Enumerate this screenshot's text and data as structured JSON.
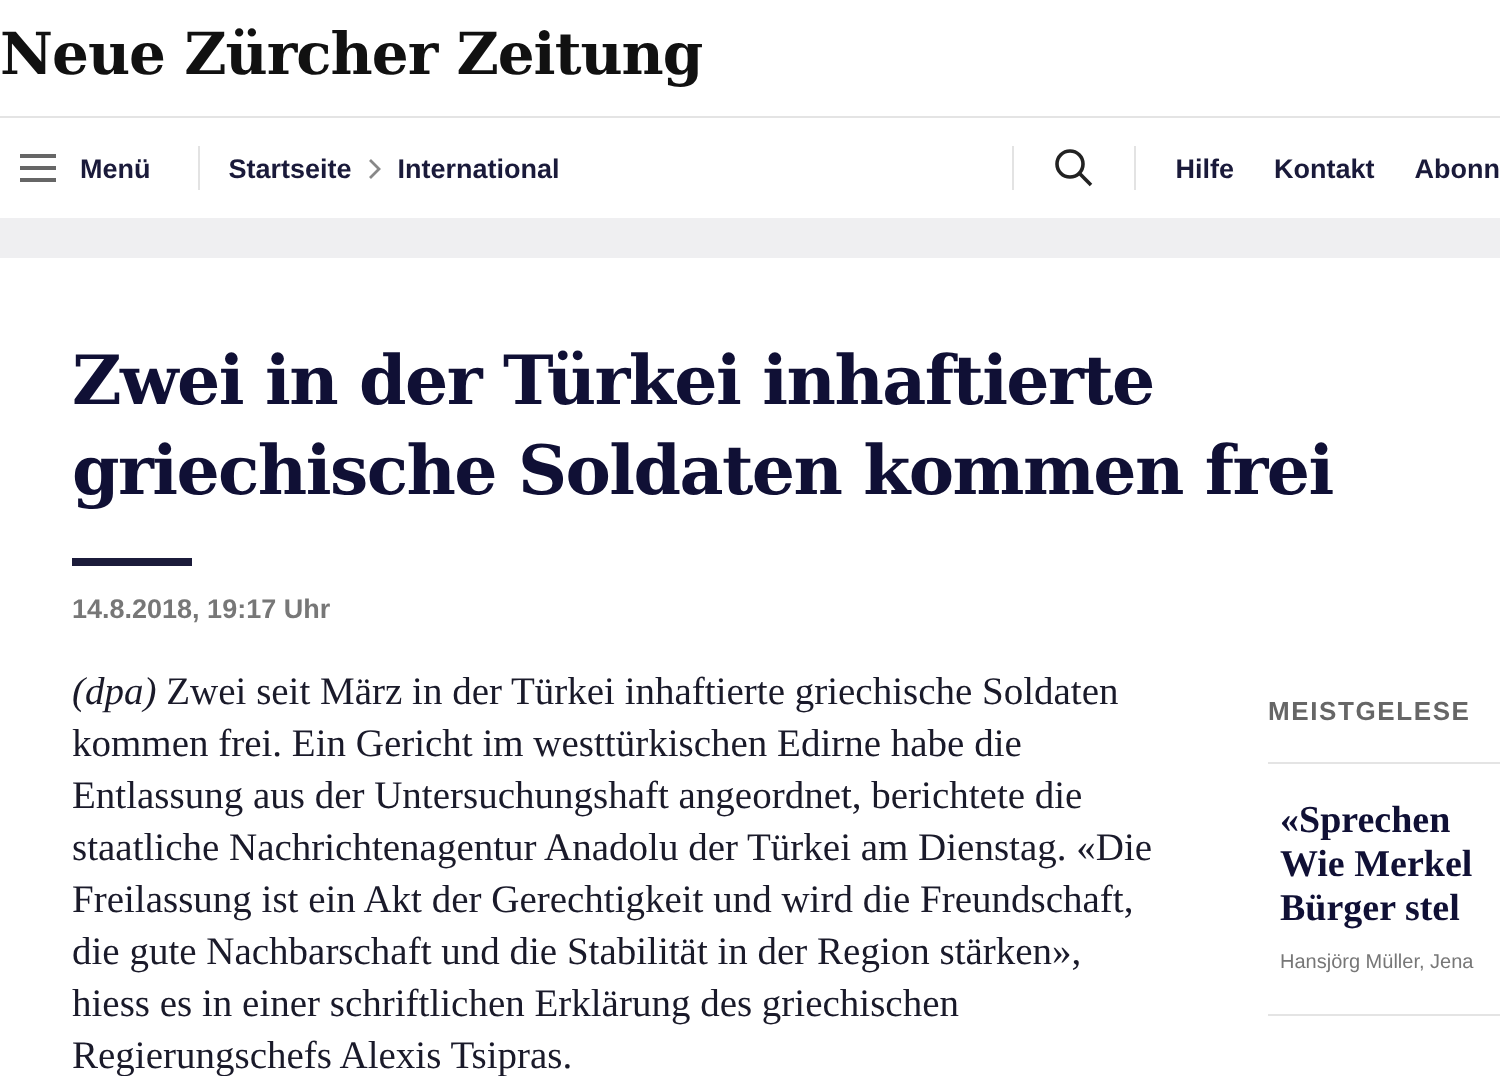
{
  "logo": "Neue Zürcher Zeitung",
  "nav": {
    "menu": "Menü",
    "breadcrumbs": [
      "Startseite",
      "International"
    ],
    "links": [
      "Hilfe",
      "Kontakt",
      "Abonn"
    ]
  },
  "article": {
    "title": "Zwei in der Türkei inhaftierte griechische Soldaten kommen frei",
    "date": "14.8.2018, 19:17 Uhr",
    "body": "*(dpa)* Zwei seit März in der Türkei inhaftierte griechische Soldaten kommen frei. Ein Gericht im westtürkischen Edirne habe die Entlassung aus der Untersuchungshaft angeordnet, berichtete die staatliche Nachrichtenagentur Anadolu der Türkei am Dienstag. «Die Freilassung ist ein Akt der Gerechtigkeit und wird die Freundschaft, die gute Nachbarschaft und die Stabilität in der Region stärken», hiess es in einer schriftlichen Erklärung des griechischen Regierungschefs Alexis Tsipras."
  },
  "sidebar": {
    "heading": "MEISTGELESE",
    "teaser": {
      "title_lines": [
        "«Sprechen",
        "Wie Merkel",
        "Bürger stel"
      ],
      "byline": "Hansjörg Müller, Jena"
    }
  }
}
